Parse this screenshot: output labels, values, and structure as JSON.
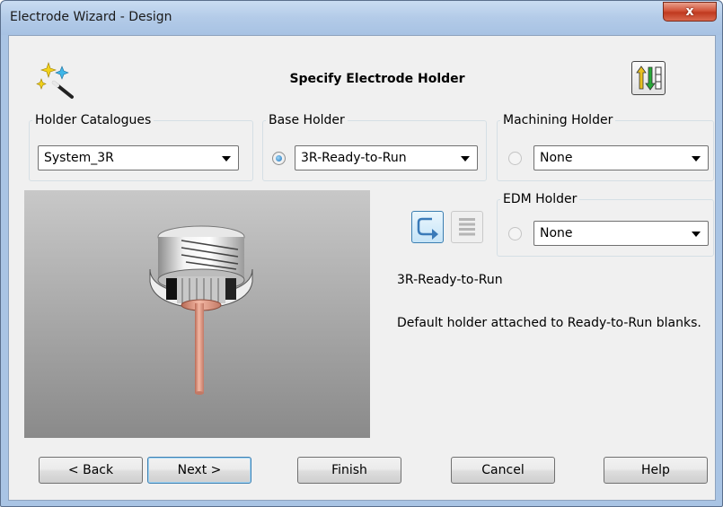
{
  "window": {
    "title": "Electrode Wizard - Design",
    "close_label": "x"
  },
  "header": {
    "title": "Specify Electrode Holder",
    "wizard_icon": "magic-wand-icon",
    "sort_icon": "sort-arrows-icon"
  },
  "groups": {
    "holder_catalogues": {
      "label": "Holder Catalogues",
      "value": "System_3R"
    },
    "base_holder": {
      "label": "Base Holder",
      "value": "3R-Ready-to-Run",
      "selected": true
    },
    "machining_holder": {
      "label": "Machining Holder",
      "value": "None",
      "selected": false
    },
    "edm_holder": {
      "label": "EDM Holder",
      "value": "None",
      "selected": false
    }
  },
  "toolbar": {
    "link_icon": "link-arrow-icon",
    "list_icon": "list-icon"
  },
  "info": {
    "name": "3R-Ready-to-Run",
    "description": "Default holder attached to Ready-to-Run blanks."
  },
  "buttons": {
    "back": "< Back",
    "next": "Next >",
    "finish": "Finish",
    "cancel": "Cancel",
    "help": "Help"
  }
}
